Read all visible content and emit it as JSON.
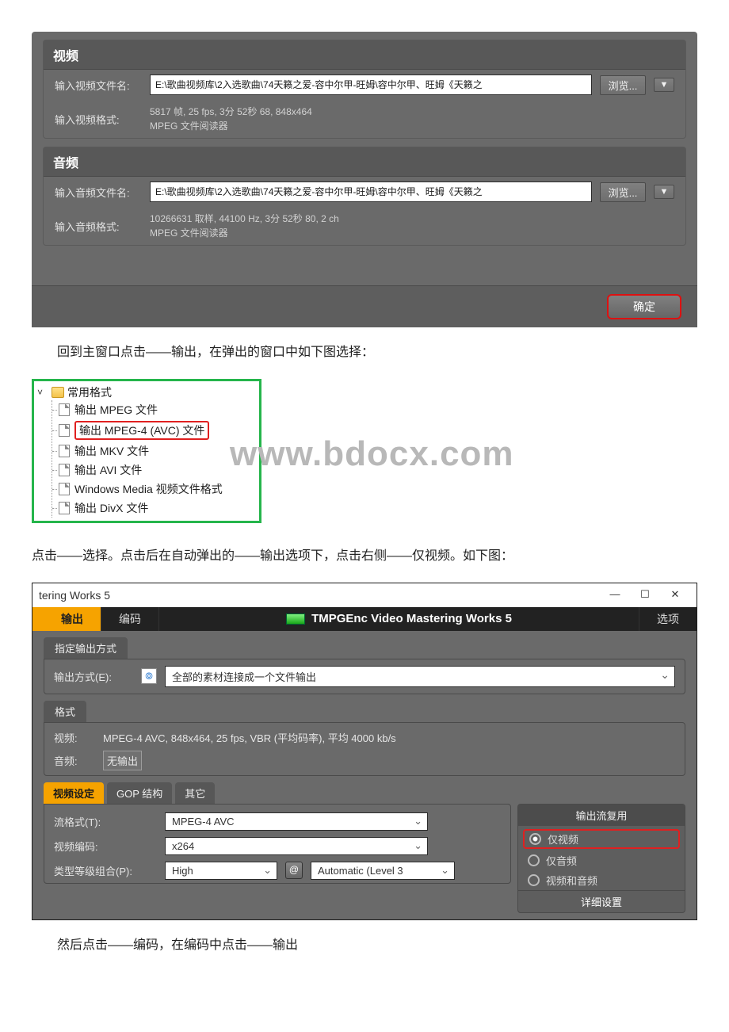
{
  "panel1": {
    "video": {
      "title": "视频",
      "file_label": "输入视频文件名:",
      "file_value": "E:\\歌曲视频库\\2入选歌曲\\74天籁之爱-容中尔甲-旺姆\\容中尔甲、旺姆《天籁之",
      "format_label": "输入视频格式:",
      "format_line1": "5817 帧, 25 fps, 3分 52秒 68, 848x464",
      "format_line2": "MPEG 文件阅读器",
      "browse": "浏览..."
    },
    "audio": {
      "title": "音频",
      "file_label": "输入音频文件名:",
      "file_value": "E:\\歌曲视频库\\2入选歌曲\\74天籁之爱-容中尔甲-旺姆\\容中尔甲、旺姆《天籁之",
      "format_label": "输入音频格式:",
      "format_line1": "10266631 取样, 44100 Hz, 3分 52秒 80, 2 ch",
      "format_line2": "MPEG 文件阅读器",
      "browse": "浏览..."
    },
    "ok": "确定"
  },
  "para1": "回到主窗口点击——输出，在弹出的窗口中如下图选择：",
  "tree": {
    "root": "常用格式",
    "items": [
      "输出 MPEG 文件",
      "输出 MPEG-4 (AVC) 文件",
      "输出 MKV 文件",
      "输出 AVI 文件",
      "Windows Media 视频文件格式",
      "输出 DivX 文件"
    ]
  },
  "watermark": "www.bdocx.com",
  "para2": "点击——选择。点击后在自动弹出的——输出选项下，点击右侧——仅视频。如下图：",
  "tmpg": {
    "title": "tering Works 5",
    "tabs": {
      "output": "输出",
      "encode": "编码",
      "options": "选项"
    },
    "brand": "TMPGEnc Video Mastering Works 5",
    "spec_title": "指定输出方式",
    "spec_label": "输出方式(E):",
    "spec_value": "全部的素材连接成一个文件输出",
    "format_title": "格式",
    "format_video_label": "视频:",
    "format_video_value": "MPEG-4 AVC, 848x464, 25 fps, VBR (平均码率), 平均 4000 kb/s",
    "format_audio_label": "音频:",
    "format_audio_value": "无输出",
    "sub_tabs": {
      "video": "视频设定",
      "gop": "GOP 结构",
      "other": "其它"
    },
    "right_header": "输出流复用",
    "radios": {
      "video_only": "仅视频",
      "audio_only": "仅音频",
      "both": "视频和音频"
    },
    "detail": "详细设置",
    "form": {
      "stream_label": "流格式(T):",
      "stream_value": "MPEG-4 AVC",
      "venc_label": "视频编码:",
      "venc_value": "x264",
      "profile_label": "类型等级组合(P):",
      "profile_value": "High",
      "level_value": "Automatic (Level 3"
    }
  },
  "para3": "然后点击——编码，在编码中点击——输出"
}
